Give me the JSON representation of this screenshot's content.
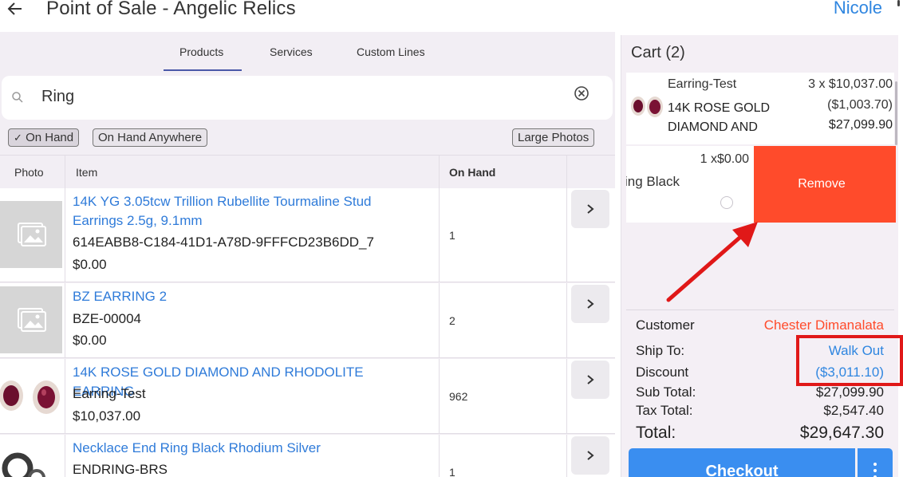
{
  "header": {
    "back_icon": "back-arrow-icon",
    "title": "Point of Sale - Angelic Relics",
    "user": "Nicole"
  },
  "tabs": [
    {
      "label": "Products",
      "active": true
    },
    {
      "label": "Services",
      "active": false
    },
    {
      "label": "Custom Lines",
      "active": false
    }
  ],
  "search": {
    "value": "Ring",
    "icon": "search-icon",
    "clear_icon": "clear-circle-icon"
  },
  "filters": {
    "on_hand": {
      "label": "On Hand",
      "checked": true
    },
    "on_hand_anywhere": {
      "label": "On Hand Anywhere",
      "checked": false
    },
    "large_photos": {
      "label": "Large Photos"
    }
  },
  "table": {
    "columns": [
      "Photo",
      "Item",
      "On Hand"
    ],
    "rows": [
      {
        "name": "14K YG 3.05tcw Trillion Rubellite Tourmaline Stud Earrings 2.5g, 9.1mm",
        "sku": "614EABB8-C184-41D1-A78D-9FFFCD23B6DD_7",
        "price": "$0.00",
        "on_hand": "1",
        "photo": "placeholder"
      },
      {
        "name": "BZ EARRING 2",
        "sku": "BZE-00004",
        "price": "$0.00",
        "on_hand": "2",
        "photo": "placeholder"
      },
      {
        "name": "14K ROSE GOLD DIAMOND AND RHODOLITE EARRING",
        "sku": "Earring-Test",
        "price": "$10,037.00",
        "on_hand": "962",
        "photo": "earrings"
      },
      {
        "name": "Necklace End Ring Black Rhodium Silver",
        "sku": "ENDRING-BRS",
        "price": "",
        "on_hand": "1",
        "photo": "ring"
      }
    ]
  },
  "cart": {
    "title": "Cart (2)",
    "item1": {
      "name": "Earring-Test",
      "desc_line1": "14K ROSE GOLD",
      "desc_line2": "DIAMOND AND",
      "qty_price": "3 x $10,037.00",
      "discount": "($1,003.70)",
      "total": "$27,099.90"
    },
    "item2": {
      "qty_price": "1 x$0.00",
      "name_partial": "ing Black",
      "remove_label": "Remove"
    },
    "summary": {
      "customer_label": "Customer",
      "customer_value": "Chester Dimanalata",
      "ship_label": "Ship To:",
      "ship_value": "Walk Out",
      "discount_label": "Discount",
      "discount_value": "($3,011.10)",
      "subtotal_label": "Sub Total:",
      "subtotal_value": "$27,099.90",
      "tax_label": "Tax Total:",
      "tax_value": "$2,547.40",
      "total_label": "Total:",
      "total_value": "$29,647.30"
    },
    "checkout_label": "Checkout",
    "more_icon": "more-vertical-icon"
  },
  "annotation_colors": {
    "arrow": "#e01818",
    "box": "#e01818"
  },
  "accent_colors": {
    "link": "#2f86e0",
    "remove": "#ff4b2b",
    "checkout": "#3a8ef0"
  }
}
